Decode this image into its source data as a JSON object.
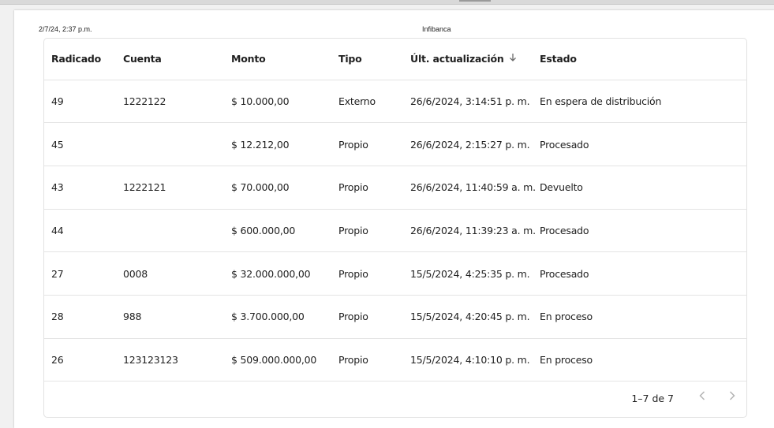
{
  "header": {
    "print_date": "2/7/24, 2:37 p.m.",
    "print_title": "Infibanca"
  },
  "table": {
    "columns": [
      "Radicado",
      "Cuenta",
      "Monto",
      "Tipo",
      "Últ. actualización",
      "Estado"
    ],
    "sort_icon": "arrow-down-icon",
    "rows": [
      [
        "49",
        "1222122",
        "$ 10.000,00",
        "Externo",
        "26/6/2024, 3:14:51 p. m.",
        "En espera de distribución"
      ],
      [
        "45",
        "",
        "$ 12.212,00",
        "Propio",
        "26/6/2024, 2:15:27 p. m.",
        "Procesado"
      ],
      [
        "43",
        "1222121",
        "$ 70.000,00",
        "Propio",
        "26/6/2024, 11:40:59 a. m.",
        "Devuelto"
      ],
      [
        "44",
        "",
        "$ 600.000,00",
        "Propio",
        "26/6/2024, 11:39:23 a. m.",
        "Procesado"
      ],
      [
        "27",
        "0008",
        "$ 32.000.000,00",
        "Propio",
        "15/5/2024, 4:25:35 p. m.",
        "Procesado"
      ],
      [
        "28",
        "988",
        "$ 3.700.000,00",
        "Propio",
        "15/5/2024, 4:20:45 p. m.",
        "En proceso"
      ],
      [
        "26",
        "123123123",
        "$ 509.000.000,00",
        "Propio",
        "15/5/2024, 4:10:10 p. m.",
        "En proceso"
      ]
    ]
  },
  "pagination": {
    "range_text": "1–7 de 7",
    "prev_icon": "chevron-left-icon",
    "next_icon": "chevron-right-icon"
  }
}
